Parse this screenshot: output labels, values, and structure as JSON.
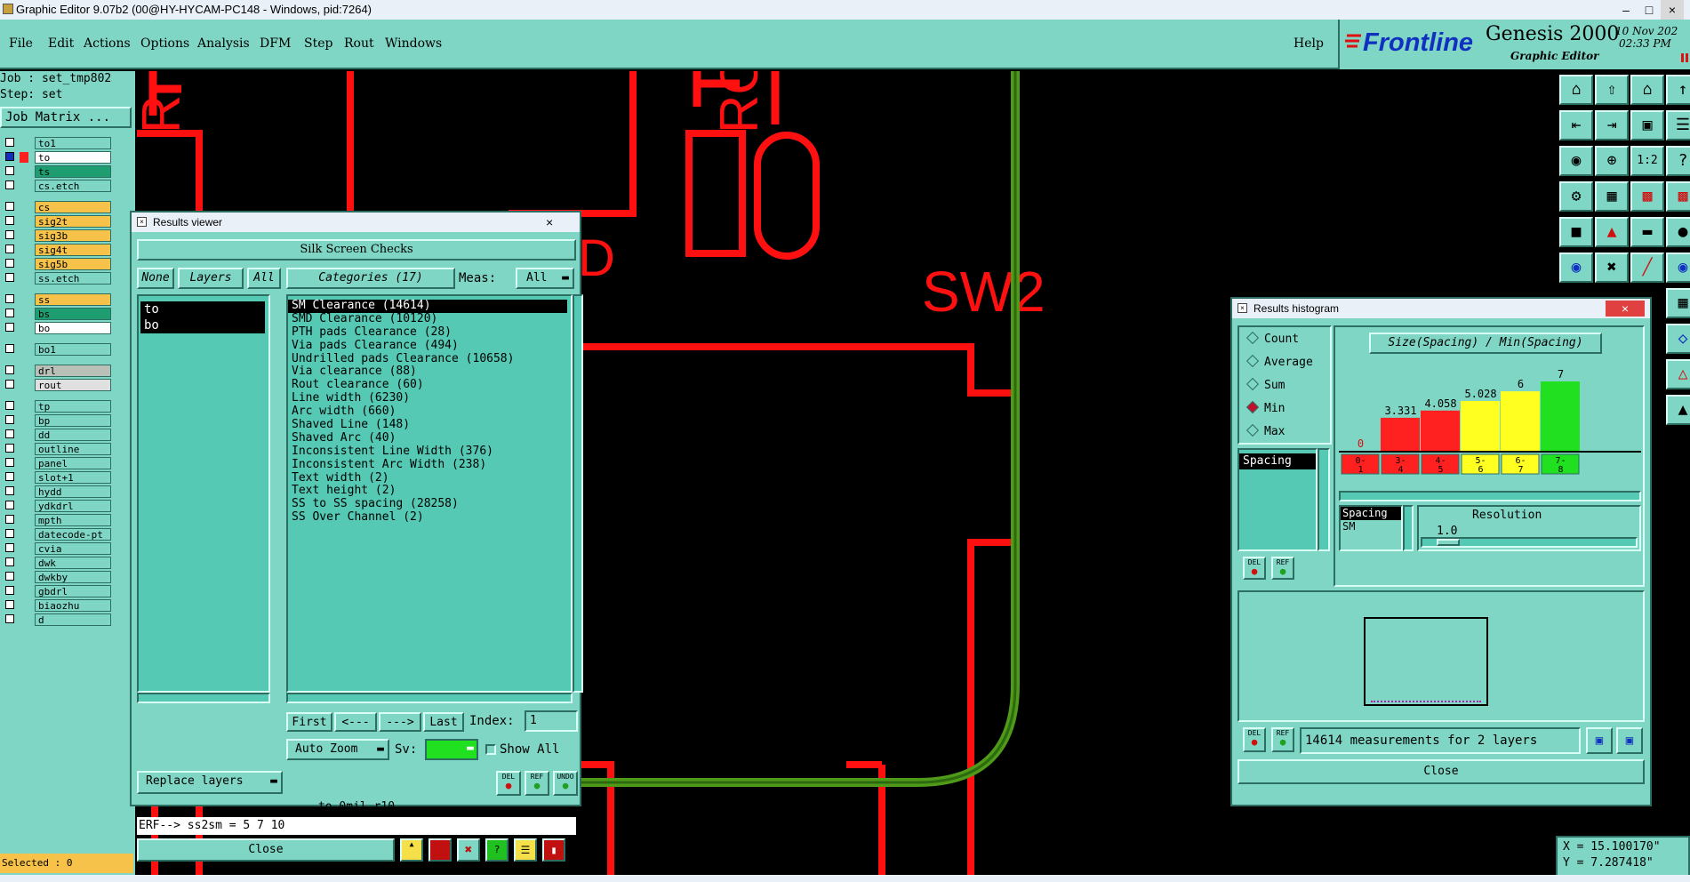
{
  "window": {
    "title": "Graphic Editor 9.07b2 (00@HY-HYCAM-PC148 - Windows, pid:7264)"
  },
  "menu": [
    "File",
    "Edit",
    "Actions",
    "Options",
    "Analysis",
    "DFM",
    "Step",
    "Rout",
    "Windows"
  ],
  "menu_help": "Help",
  "brand": {
    "logo": "Frontline",
    "product": "Genesis 2000",
    "sub": "Graphic Editor",
    "date": "10 Nov 202",
    "time": "02:33 PM"
  },
  "job": {
    "job_line": "Job : set_tmp802",
    "step_line": "Step: set",
    "matrix_button": "Job Matrix ..."
  },
  "layers": [
    {
      "name": "to1",
      "color": "#7fd6c4"
    },
    {
      "name": "to",
      "color": "#ffffff",
      "active": true
    },
    {
      "name": "ts",
      "color": "#1e9e70"
    },
    {
      "name": "cs.etch",
      "color": "#7fd6c4"
    },
    {
      "name": "cs",
      "color": "#f6c24a"
    },
    {
      "name": "sig2t",
      "color": "#f6c24a"
    },
    {
      "name": "sig3b",
      "color": "#f6c24a"
    },
    {
      "name": "sig4t",
      "color": "#f6c24a"
    },
    {
      "name": "sig5b",
      "color": "#f6c24a"
    },
    {
      "name": "ss.etch",
      "color": "#7fd6c4"
    },
    {
      "name": "ss",
      "color": "#f6c24a"
    },
    {
      "name": "bs",
      "color": "#1e9e70"
    },
    {
      "name": "bo",
      "color": "#ffffff"
    },
    {
      "name": "bo1",
      "color": "#7fd6c4"
    },
    {
      "name": "drl",
      "color": "#b8c0b8"
    },
    {
      "name": "rout",
      "color": "#e0e0e0"
    },
    {
      "name": "tp",
      "color": "#7fd6c4"
    },
    {
      "name": "bp",
      "color": "#7fd6c4"
    },
    {
      "name": "dd",
      "color": "#7fd6c4"
    },
    {
      "name": "outline",
      "color": "#7fd6c4"
    },
    {
      "name": "panel",
      "color": "#7fd6c4"
    },
    {
      "name": "slot+1",
      "color": "#7fd6c4"
    },
    {
      "name": "hydd",
      "color": "#7fd6c4"
    },
    {
      "name": "ydkdrl",
      "color": "#7fd6c4"
    },
    {
      "name": "mpth",
      "color": "#7fd6c4"
    },
    {
      "name": "datecode-pt",
      "color": "#7fd6c4"
    },
    {
      "name": "cvia",
      "color": "#7fd6c4"
    },
    {
      "name": "dwk",
      "color": "#7fd6c4"
    },
    {
      "name": "dwkby",
      "color": "#7fd6c4"
    },
    {
      "name": "gbdrl",
      "color": "#7fd6c4"
    },
    {
      "name": "biaozhu",
      "color": "#7fd6c4"
    },
    {
      "name": "d",
      "color": "#7fd6c4"
    }
  ],
  "selected_status": "Selected : 0",
  "canvas": {
    "label_sw2": "SW2",
    "label_r_left": "R",
    "label_rc2": "RC2",
    "label_d": "D"
  },
  "results_viewer": {
    "title": "Results viewer",
    "header": "Silk Screen Checks",
    "none_btn": "None",
    "layers_btn": "Layers",
    "all_btn": "All",
    "categories_btn": "Categories (17)",
    "meas_label": "Meas:",
    "meas_value": "All",
    "layer_items": [
      "to",
      "bo"
    ],
    "categories": [
      "SM Clearance (14614)",
      "SMD Clearance (10120)",
      "PTH pads Clearance (28)",
      "Via pads Clearance (494)",
      "Undrilled pads Clearance (10658)",
      "Via clearance (88)",
      "Rout clearance (60)",
      "Line width (6230)",
      "Arc width (660)",
      "Shaved Line (148)",
      "Shaved Arc (40)",
      "Inconsistent Line Width (376)",
      "Inconsistent Arc Width (238)",
      "Text width (2)",
      "Text height (2)",
      "SS to SS spacing (28258)",
      "SS Over Channel (2)"
    ],
    "nav": {
      "first": "First",
      "prev": "<---",
      "next": "--->",
      "last": "Last",
      "index_label": "Index:",
      "index_value": "1"
    },
    "auto_zoom": "Auto Zoom",
    "sv_label": "Sv:",
    "show_all": "Show All",
    "replace_layers": "Replace layers",
    "del": "DEL",
    "ref": "REF",
    "undo": "UNDO",
    "status_line": "to 0mil   r10",
    "erf_line": "ERF--> ss2sm = 5 7 10",
    "close": "Close"
  },
  "histogram": {
    "title": "Results histogram",
    "radio": [
      "Count",
      "Average",
      "Sum",
      "Min",
      "Max"
    ],
    "radio_selected": "Min",
    "heading": "Size(Spacing) / Min(Spacing)",
    "left_list_item": "Spacing",
    "spacing_label": "Spacing",
    "spacing_value": "SM",
    "resolution_label": "Resolution",
    "resolution_value": "1.0",
    "measurements": "14614 measurements for 2 layers",
    "del": "DEL",
    "ref": "REF",
    "close": "Close"
  },
  "chart_data": {
    "type": "bar",
    "categories": [
      "0-1",
      "3-4",
      "4-5",
      "5-6",
      "6-7",
      "7-8"
    ],
    "values": [
      0,
      3.331,
      4.058,
      5.028,
      6,
      7
    ],
    "value_labels": [
      "0",
      "3.331",
      "4.058",
      "5.028",
      "6",
      "7"
    ],
    "colors": [
      "#ff2020",
      "#ff2020",
      "#ff2020",
      "#ffff20",
      "#ffff20",
      "#20e020"
    ],
    "title": "Size(Spacing) / Min(Spacing)",
    "ylim": [
      0,
      7
    ]
  },
  "coords": {
    "x": "X = 15.100170\"",
    "y": "Y = 7.287418\""
  }
}
